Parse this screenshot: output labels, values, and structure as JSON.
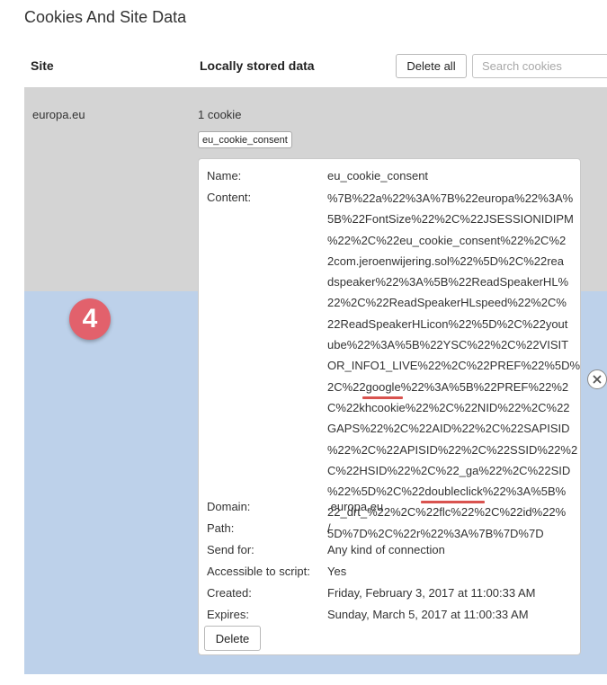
{
  "title": "Cookies And Site Data",
  "table": {
    "col_site": "Site",
    "col_data": "Locally stored data"
  },
  "toolbar": {
    "delete_all_label": "Delete all",
    "search_placeholder": "Search cookies"
  },
  "site": {
    "name": "europa.eu",
    "cookie_count": "1 cookie",
    "cookie_chip": "eu_cookie_consent"
  },
  "badge": {
    "number": "4",
    "color": "#e2616c"
  },
  "details": {
    "name_label": "Name:",
    "name_value": "eu_cookie_consent",
    "content_label": "Content:",
    "content_lines": [
      "%7B%22a%22%3A%7B%22europa%22%3A%",
      "5B%22FontSize%22%2C%22JSESSIONIDIPM",
      "%22%2C%22eu_cookie_consent%22%2C%2",
      "2com.jeroenwijering.sol%22%5D%2C%22rea",
      "dspeaker%22%3A%5B%22ReadSpeakerHL%",
      "22%2C%22ReadSpeakerHLspeed%22%2C%",
      "22ReadSpeakerHLicon%22%5D%2C%22yout",
      "ube%22%3A%5B%22YSC%22%2C%22VISIT",
      "OR_INFO1_LIVE%22%2C%22PREF%22%5D%",
      "2C%22google%22%3A%5B%22PREF%22%2",
      "C%22khcookie%22%2C%22NID%22%2C%22",
      "GAPS%22%2C%22AID%22%2C%22SAPISID",
      "%22%2C%22APISID%22%2C%22SSID%22%2",
      "C%22HSID%22%2C%22_ga%22%2C%22SID",
      "%22%5D%2C%22doubleclick%22%3A%5B%",
      "22_drt_%22%2C%22flc%22%2C%22id%22%",
      "5D%7D%2C%22r%22%3A%7B%7D%7D"
    ],
    "content_highlight_9": {
      "pre": "2C%22",
      "mark": "google",
      "post": "%22%3A%5B%22PREF%22%2"
    },
    "content_highlight_14": {
      "pre": "%22%5D%2C%22",
      "mark": "doubleclick",
      "post": "%22%3A%5B%"
    },
    "highlight_color": "#d9534f",
    "domain_label": "Domain:",
    "domain_value": ".europa.eu",
    "path_label": "Path:",
    "path_value": "/",
    "send_for_label": "Send for:",
    "send_for_value": "Any kind of connection",
    "accessible_label": "Accessible to script:",
    "accessible_value": "Yes",
    "created_label": "Created:",
    "created_value": "Friday, February 3, 2017 at 11:00:33 AM",
    "expires_label": "Expires:",
    "expires_value": "Sunday, March 5, 2017 at 11:00:33 AM",
    "delete_label": "Delete"
  }
}
